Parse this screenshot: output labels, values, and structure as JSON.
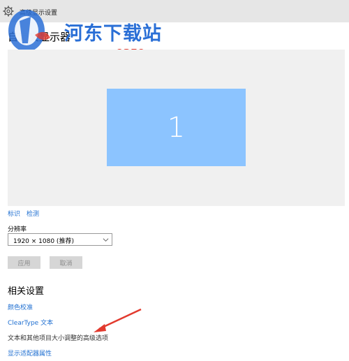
{
  "window": {
    "title": "高级显示设置",
    "icon": "gear-icon"
  },
  "watermark": {
    "name": "河东下载站",
    "url": "www.pc0359.cn"
  },
  "page": {
    "heading": "自定义显示器"
  },
  "display_preview": {
    "monitor_number": "1",
    "monitor_color": "#8cc4ff",
    "background_color": "#f0f0f0"
  },
  "display_links": {
    "identify": "标识",
    "detect": "检测"
  },
  "resolution": {
    "label": "分辨率",
    "selected": "1920 × 1080 (推荐)"
  },
  "buttons": {
    "apply": "应用",
    "cancel": "取消"
  },
  "related": {
    "heading": "相关设置",
    "items": [
      {
        "label": "颜色校准"
      },
      {
        "label": "ClearType 文本"
      },
      {
        "label": "文本和其他项目大小调整的高级选项"
      },
      {
        "label": "显示适配器属性"
      }
    ]
  },
  "colors": {
    "link": "#1f6fd1",
    "titlebar": "#e6e6e6",
    "arrow": "#e23a2e",
    "watermark_blue": "#2a6fd6",
    "watermark_red": "#e23a2e"
  }
}
